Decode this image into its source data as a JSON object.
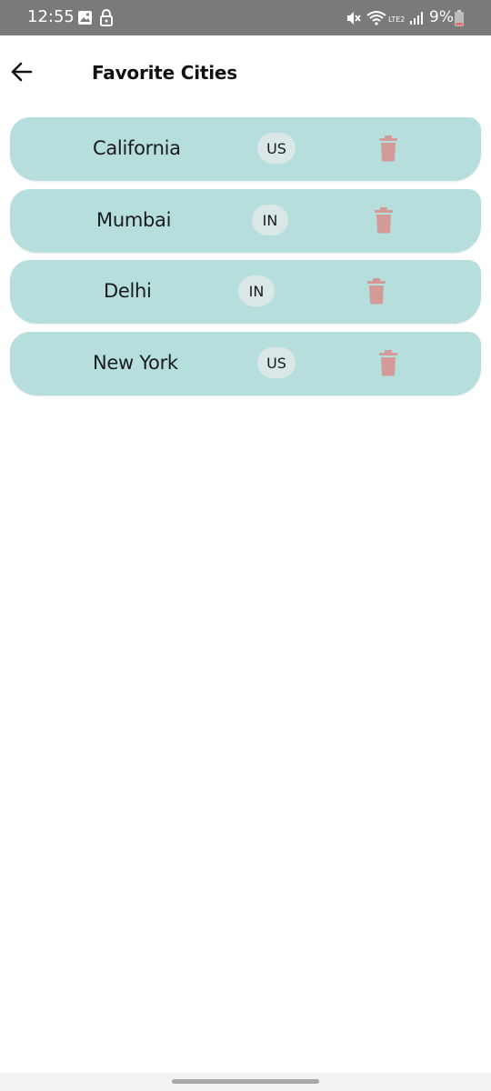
{
  "status_bar": {
    "time": "12:55",
    "battery_percent": "9%",
    "network_label": "LTE2",
    "icons": [
      "image-icon",
      "lock-icon",
      "mute-icon",
      "wifi-icon",
      "signal-icon",
      "battery-icon"
    ]
  },
  "header": {
    "title": "Favorite Cities",
    "back_icon": "arrow-left-icon"
  },
  "cities": [
    {
      "name": "California",
      "country": "US"
    },
    {
      "name": "Mumbai",
      "country": "IN"
    },
    {
      "name": "Delhi",
      "country": "IN"
    },
    {
      "name": "New York",
      "country": "US"
    }
  ],
  "colors": {
    "card_background": "#b5dedc",
    "chip_background": "#d9e8e7",
    "delete_icon": "#d39a98",
    "status_bar": "#7a7a7a"
  },
  "delete_icon": "trash-icon"
}
